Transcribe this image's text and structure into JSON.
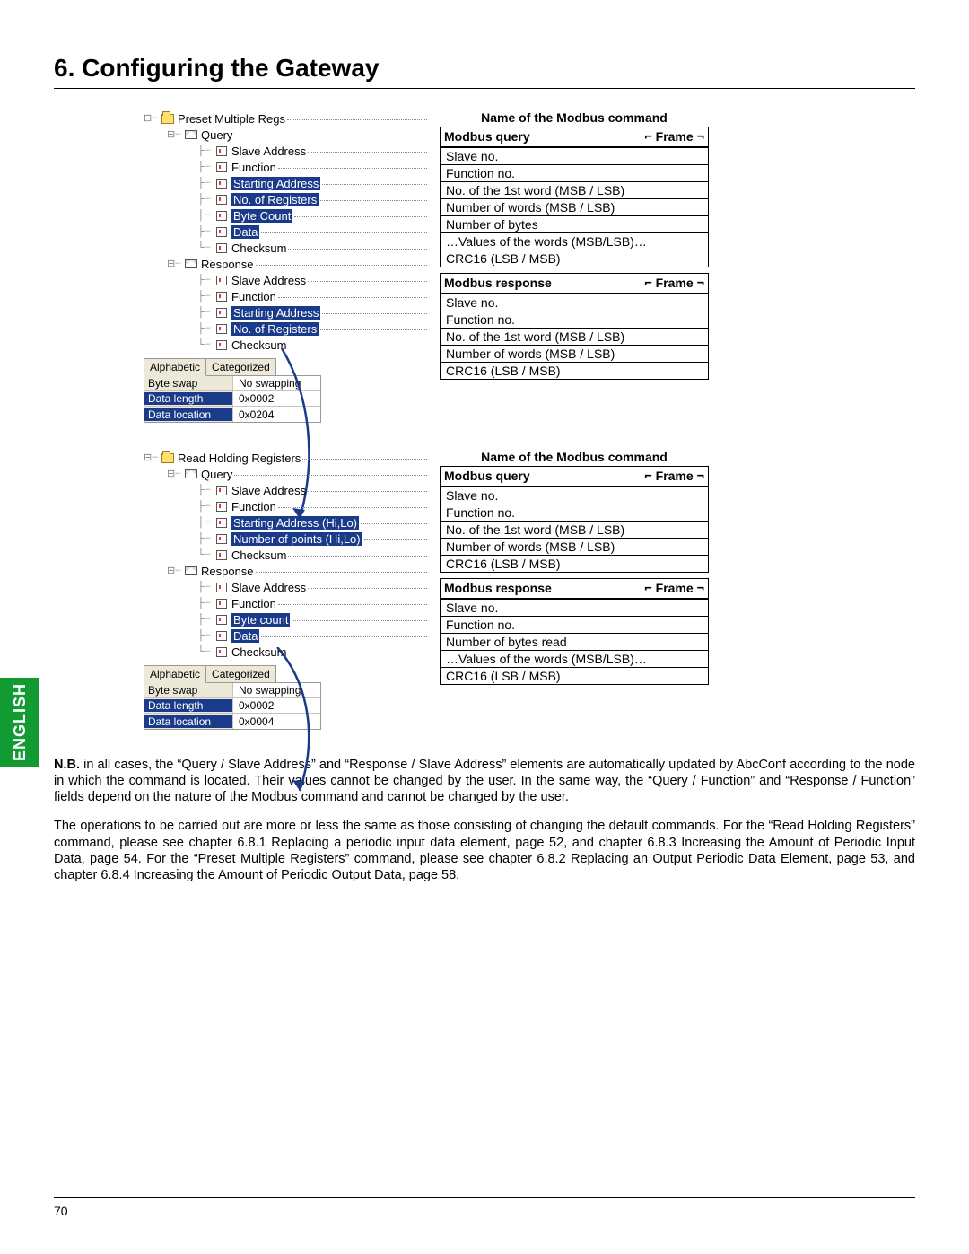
{
  "header": {
    "title": "6. Configuring the Gateway"
  },
  "side_tab": "ENGLISH",
  "page_number": "70",
  "section1": {
    "root_label": "Preset Multiple Regs",
    "query_label": "Query",
    "response_label": "Response",
    "query_fields": [
      {
        "label": "Slave Address",
        "hl": false
      },
      {
        "label": "Function",
        "hl": false
      },
      {
        "label": "Starting Address",
        "hl": true
      },
      {
        "label": "No. of Registers",
        "hl": true
      },
      {
        "label": "Byte Count",
        "hl": true
      },
      {
        "label": "Data",
        "hl": true
      },
      {
        "label": "Checksum",
        "hl": false
      }
    ],
    "response_fields": [
      {
        "label": "Slave Address",
        "hl": false
      },
      {
        "label": "Function",
        "hl": false
      },
      {
        "label": "Starting Address",
        "hl": true
      },
      {
        "label": "No. of Registers",
        "hl": true
      },
      {
        "label": "Checksum",
        "hl": false
      }
    ],
    "tabs": [
      "Alphabetic",
      "Categorized"
    ],
    "props": [
      {
        "k": "Byte swap",
        "v": "No swapping",
        "sel": false
      },
      {
        "k": "Data length",
        "v": "0x0002",
        "sel": true
      },
      {
        "k": "Data location",
        "v": "0x0204",
        "sel": true
      }
    ],
    "right": {
      "caption": "Name of the Modbus command",
      "q_title": "Modbus query",
      "r_title": "Modbus response",
      "frame_left": "↙",
      "frame_mid": "Frame",
      "frame_right": "↘",
      "query_rows": [
        "Slave no.",
        "Function no.",
        "No. of the 1st word (MSB / LSB)",
        "Number of words (MSB / LSB)",
        "Number of bytes",
        "…Values of the words (MSB/LSB)…",
        "CRC16 (LSB / MSB)"
      ],
      "response_rows": [
        "Slave no.",
        "Function no.",
        "No. of the 1st word (MSB / LSB)",
        "Number of words (MSB / LSB)",
        "CRC16 (LSB / MSB)"
      ]
    }
  },
  "section2": {
    "root_label": "Read Holding Registers",
    "query_label": "Query",
    "response_label": "Response",
    "query_fields": [
      {
        "label": "Slave Address",
        "hl": false
      },
      {
        "label": "Function",
        "hl": false
      },
      {
        "label": "Starting Address (Hi,Lo)",
        "hl": true
      },
      {
        "label": "Number of points (Hi,Lo)",
        "hl": true
      },
      {
        "label": "Checksum",
        "hl": false
      }
    ],
    "response_fields": [
      {
        "label": "Slave Address",
        "hl": false
      },
      {
        "label": "Function",
        "hl": false
      },
      {
        "label": "Byte count",
        "hl": true
      },
      {
        "label": "Data",
        "hl": true
      },
      {
        "label": "Checksum",
        "hl": false
      }
    ],
    "tabs": [
      "Alphabetic",
      "Categorized"
    ],
    "props": [
      {
        "k": "Byte swap",
        "v": "No swapping",
        "sel": false
      },
      {
        "k": "Data length",
        "v": "0x0002",
        "sel": true
      },
      {
        "k": "Data location",
        "v": "0x0004",
        "sel": true
      }
    ],
    "right": {
      "caption": "Name of the Modbus command",
      "q_title": "Modbus query",
      "r_title": "Modbus response",
      "frame_left": "↙",
      "frame_mid": "Frame",
      "frame_right": "↘",
      "query_rows": [
        "Slave no.",
        "Function no.",
        "No. of the 1st word (MSB / LSB)",
        "Number of words (MSB / LSB)",
        "CRC16 (LSB / MSB)"
      ],
      "response_rows": [
        "Slave no.",
        "Function no.",
        "Number of bytes read",
        "…Values of the words (MSB/LSB)…",
        "CRC16 (LSB / MSB)"
      ]
    }
  },
  "body": {
    "p1": "N.B. in all cases, the “Query / Slave Address” and “Response / Slave Address” elements are automatically updated by AbcConf according to the node in which the command is located. Their values cannot be changed by the user. In the same way, the “Query / Function” and “Response / Function” fields depend on the nature of the Modbus command and cannot be changed by the user.",
    "p1_bold_lead": "N.B.",
    "p2": "The operations to be carried out are more or less the same as those consisting of changing the default commands. For the “Read Holding Registers” command, please see chapter 6.8.1 Replacing a periodic input data element, page 52, and chapter 6.8.3 Increasing the Amount of Periodic Input Data, page 54. For the “Preset Multiple Registers” command, please see chapter 6.8.2 Replacing an Output Periodic Data Element, page 53, and chapter 6.8.4 Increasing the Amount of Periodic Output Data, page 58."
  }
}
